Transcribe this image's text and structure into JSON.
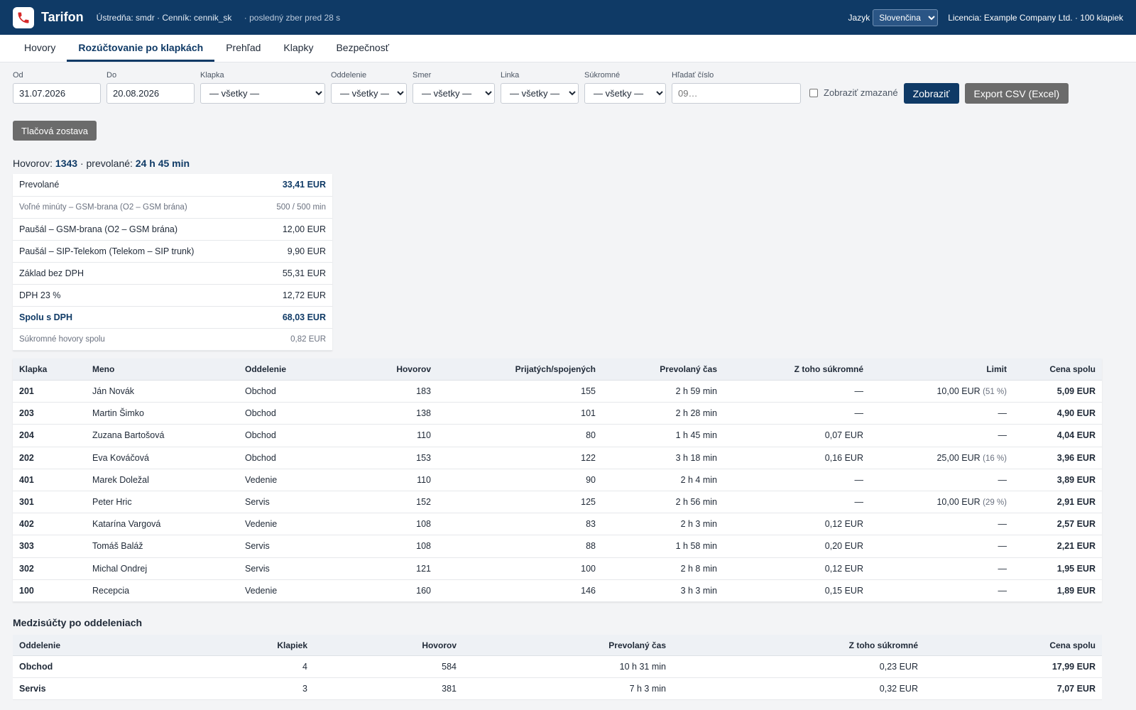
{
  "header": {
    "brand": "Tarifon",
    "info": "Ústredňa: smdr · Cenník: cennik_sk",
    "last_collect": "· posledný zber pred 28 s",
    "lang_label": "Jazyk",
    "lang_value": "Slovenčina",
    "license": "Licencia: Example Company Ltd. · 100 klapiek"
  },
  "tabs": [
    "Hovory",
    "Rozúčtovanie po klapkách",
    "Prehľad",
    "Klapky",
    "Bezpečnosť"
  ],
  "filters": {
    "from_label": "Od",
    "from_value": "31.07.2026",
    "to_label": "Do",
    "to_value": "20.08.2026",
    "ext_label": "Klapka",
    "ext_value": "— všetky —",
    "dept_label": "Oddelenie",
    "dept_value": "— všetky —",
    "dir_label": "Smer",
    "dir_value": "— všetky —",
    "line_label": "Linka",
    "line_value": "— všetky —",
    "private_label": "Súkromné",
    "private_value": "— všetky —",
    "search_label": "Hľadať číslo",
    "search_placeholder": "09…",
    "show_deleted": "Zobraziť zmazané",
    "show_button": "Zobraziť",
    "export_button": "Export CSV (Excel)"
  },
  "print_button": "Tlačová zostava",
  "summary": {
    "calls_label": "Hovorov:",
    "calls_value": "1343",
    "talk_label": "· prevolané:",
    "talk_value": "24 h 45 min"
  },
  "costs": [
    {
      "label": "Prevolané",
      "value": "33,41 EUR",
      "style": "hl"
    },
    {
      "label": "Voľné minúty – GSM-brana (O2 – GSM brána)",
      "value": "500 / 500 min",
      "style": "small"
    },
    {
      "label": "Paušál – GSM-brana (O2 – GSM brána)",
      "value": "12,00 EUR",
      "style": ""
    },
    {
      "label": "Paušál – SIP-Telekom (Telekom – SIP trunk)",
      "value": "9,90 EUR",
      "style": ""
    },
    {
      "label": "Základ bez DPH",
      "value": "55,31 EUR",
      "style": ""
    },
    {
      "label": "DPH 23 %",
      "value": "12,72 EUR",
      "style": ""
    },
    {
      "label": "Spolu s DPH",
      "value": "68,03 EUR",
      "style": "total"
    },
    {
      "label": "Súkromné hovory spolu",
      "value": "0,82 EUR",
      "style": "small"
    }
  ],
  "ext_table": {
    "headers": [
      "Klapka",
      "Meno",
      "Oddelenie",
      "Hovorov",
      "Prijatých/spojených",
      "Prevolaný čas",
      "Z toho súkromné",
      "Limit",
      "Cena spolu"
    ],
    "rows": [
      {
        "ext": "201",
        "name": "Ján Novák",
        "dept": "Obchod",
        "calls": "183",
        "received": "155",
        "time": "2 h 59 min",
        "private": "—",
        "limit": "10,00 EUR",
        "pct": "(51 %)",
        "price": "5,09 EUR"
      },
      {
        "ext": "203",
        "name": "Martin Šimko",
        "dept": "Obchod",
        "calls": "138",
        "received": "101",
        "time": "2 h 28 min",
        "private": "—",
        "limit": "—",
        "pct": "",
        "price": "4,90 EUR"
      },
      {
        "ext": "204",
        "name": "Zuzana Bartošová",
        "dept": "Obchod",
        "calls": "110",
        "received": "80",
        "time": "1 h 45 min",
        "private": "0,07 EUR",
        "limit": "—",
        "pct": "",
        "price": "4,04 EUR"
      },
      {
        "ext": "202",
        "name": "Eva Kováčová",
        "dept": "Obchod",
        "calls": "153",
        "received": "122",
        "time": "3 h 18 min",
        "private": "0,16 EUR",
        "limit": "25,00 EUR",
        "pct": "(16 %)",
        "price": "3,96 EUR"
      },
      {
        "ext": "401",
        "name": "Marek Doležal",
        "dept": "Vedenie",
        "calls": "110",
        "received": "90",
        "time": "2 h 4 min",
        "private": "—",
        "limit": "—",
        "pct": "",
        "price": "3,89 EUR"
      },
      {
        "ext": "301",
        "name": "Peter Hric",
        "dept": "Servis",
        "calls": "152",
        "received": "125",
        "time": "2 h 56 min",
        "private": "—",
        "limit": "10,00 EUR",
        "pct": "(29 %)",
        "price": "2,91 EUR"
      },
      {
        "ext": "402",
        "name": "Katarína Vargová",
        "dept": "Vedenie",
        "calls": "108",
        "received": "83",
        "time": "2 h 3 min",
        "private": "0,12 EUR",
        "limit": "—",
        "pct": "",
        "price": "2,57 EUR"
      },
      {
        "ext": "303",
        "name": "Tomáš Baláž",
        "dept": "Servis",
        "calls": "108",
        "received": "88",
        "time": "1 h 58 min",
        "private": "0,20 EUR",
        "limit": "—",
        "pct": "",
        "price": "2,21 EUR"
      },
      {
        "ext": "302",
        "name": "Michal Ondrej",
        "dept": "Servis",
        "calls": "121",
        "received": "100",
        "time": "2 h 8 min",
        "private": "0,12 EUR",
        "limit": "—",
        "pct": "",
        "price": "1,95 EUR"
      },
      {
        "ext": "100",
        "name": "Recepcia",
        "dept": "Vedenie",
        "calls": "160",
        "received": "146",
        "time": "3 h 3 min",
        "private": "0,15 EUR",
        "limit": "—",
        "pct": "",
        "price": "1,89 EUR"
      }
    ]
  },
  "dept_section_title": "Medzisúčty po oddeleniach",
  "dept_table": {
    "headers": [
      "Oddelenie",
      "Klapiek",
      "Hovorov",
      "Prevolaný čas",
      "Z toho súkromné",
      "Cena spolu"
    ],
    "rows": [
      {
        "dept": "Obchod",
        "exts": "4",
        "calls": "584",
        "time": "10 h 31 min",
        "private": "0,23 EUR",
        "price": "17,99 EUR"
      },
      {
        "dept": "Servis",
        "exts": "3",
        "calls": "381",
        "time": "7 h 3 min",
        "private": "0,32 EUR",
        "price": "7,07 EUR"
      }
    ]
  }
}
